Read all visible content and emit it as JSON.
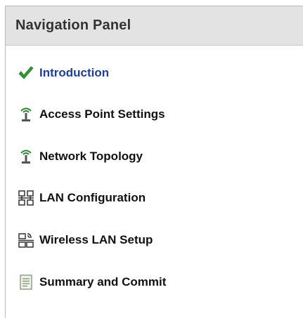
{
  "panel": {
    "title": "Navigation Panel",
    "items": [
      {
        "label": "Introduction",
        "icon": "checkmark-icon",
        "active": true
      },
      {
        "label": "Access Point Settings",
        "icon": "access-point-icon",
        "active": false
      },
      {
        "label": "Network Topology",
        "icon": "access-point-icon",
        "active": false
      },
      {
        "label": "LAN Configuration",
        "icon": "lan-icon",
        "active": false
      },
      {
        "label": "Wireless LAN Setup",
        "icon": "wireless-lan-icon",
        "active": false
      },
      {
        "label": "Summary and Commit",
        "icon": "document-icon",
        "active": false
      }
    ]
  },
  "colors": {
    "header_bg": "#e3e3e3",
    "active_text": "#1f3f9c",
    "check_green": "#2e9a2e"
  }
}
